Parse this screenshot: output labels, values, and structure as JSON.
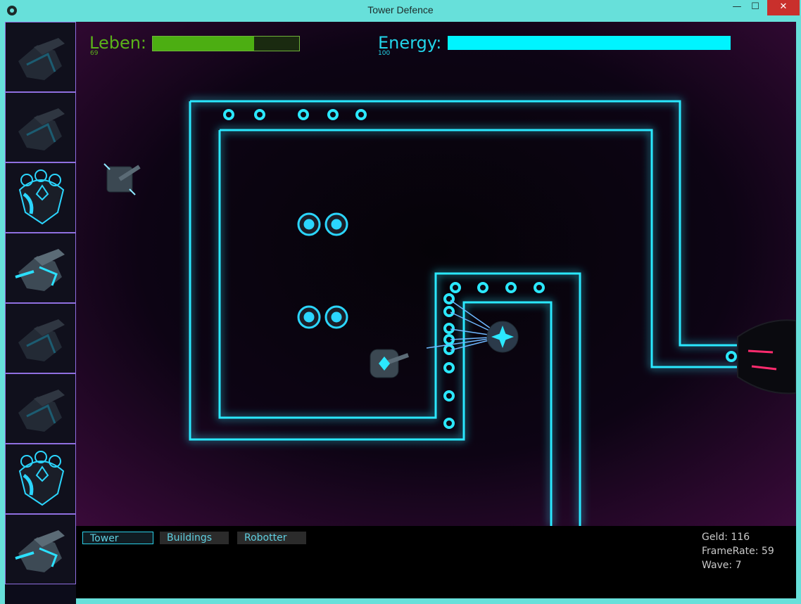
{
  "window": {
    "title": "Tower Defence",
    "minimize_icon": "minimize-icon",
    "maximize_icon": "maximize-icon",
    "close_icon": "close-icon",
    "minimize_glyph": "—",
    "maximize_glyph": "☐",
    "close_glyph": "✕"
  },
  "hud": {
    "leben_label": "Leben:",
    "leben_value": "69",
    "leben_fraction": 0.69,
    "energy_label": "Energy:",
    "energy_value": "100",
    "energy_fraction": 1.0,
    "leben_color": "#4cae12",
    "energy_color": "#00f4ff"
  },
  "sidebar": {
    "items": [
      {
        "kind": "cannon-tower",
        "state": "locked"
      },
      {
        "kind": "cannon-tower",
        "state": "locked"
      },
      {
        "kind": "shield-tower",
        "state": "available"
      },
      {
        "kind": "cannon-tower",
        "state": "available"
      },
      {
        "kind": "cannon-tower",
        "state": "locked"
      },
      {
        "kind": "cannon-tower",
        "state": "locked"
      },
      {
        "kind": "shield-tower",
        "state": "available"
      },
      {
        "kind": "cannon-tower",
        "state": "available"
      }
    ]
  },
  "tabs": [
    {
      "label": "Tower",
      "active": true
    },
    {
      "label": "Buildings",
      "active": false
    },
    {
      "label": "Robotter",
      "active": false
    }
  ],
  "stats": {
    "geld_label": "Geld:",
    "geld_value": "116",
    "framerate_label": "FrameRate:",
    "framerate_value": "59",
    "wave_label": "Wave:",
    "wave_value": "7"
  },
  "colors": {
    "path_neon": "#2be8ff",
    "field_glow": "#3a0a3a",
    "accent": "#67e0da"
  }
}
